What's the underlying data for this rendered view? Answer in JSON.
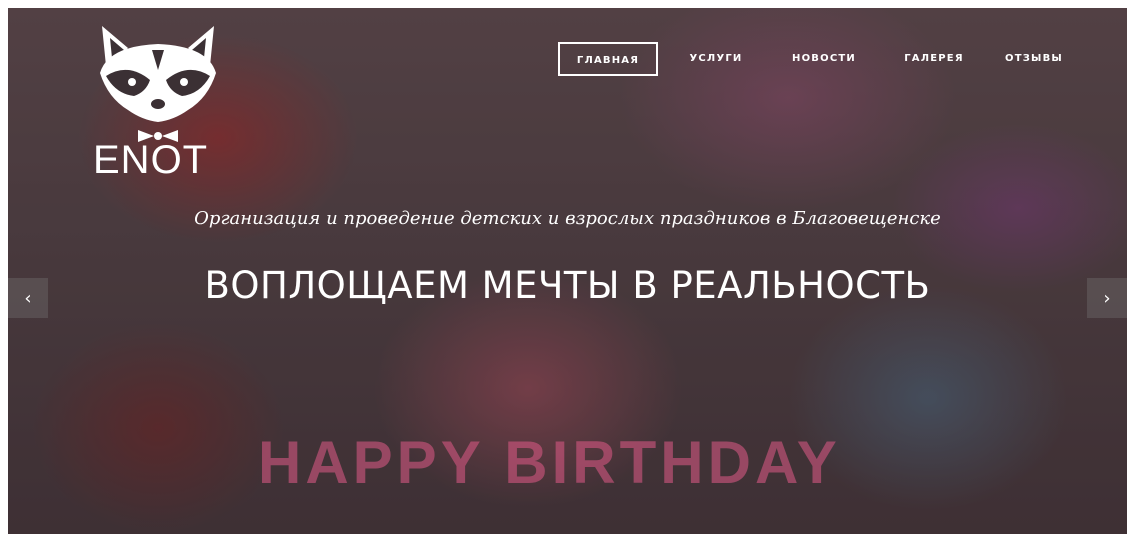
{
  "logo": {
    "text": "ENOT",
    "icon": "raccoon-icon"
  },
  "nav": {
    "items": [
      {
        "label": "ГЛАВНАЯ",
        "active": true
      },
      {
        "label": "УСЛУГИ",
        "active": false
      },
      {
        "label": "НОВОСТИ",
        "active": false
      },
      {
        "label": "ГАЛЕРЕЯ",
        "active": false
      },
      {
        "label": "ОТЗЫВЫ",
        "active": false
      }
    ]
  },
  "hero": {
    "subtitle": "Организация и проведение детских и взрослых праздников в Благовещенске",
    "headline": "ВОПЛОЩАЕМ МЕЧТЫ В РЕАЛЬНОСТЬ",
    "decorative_text": "HAPPY BIRTHDAY"
  },
  "carousel": {
    "prev_icon": "chevron-left-icon",
    "next_icon": "chevron-right-icon",
    "prev_glyph": "‹",
    "next_glyph": "›"
  },
  "colors": {
    "text": "#ffffff",
    "overlay": "#2a2024"
  }
}
